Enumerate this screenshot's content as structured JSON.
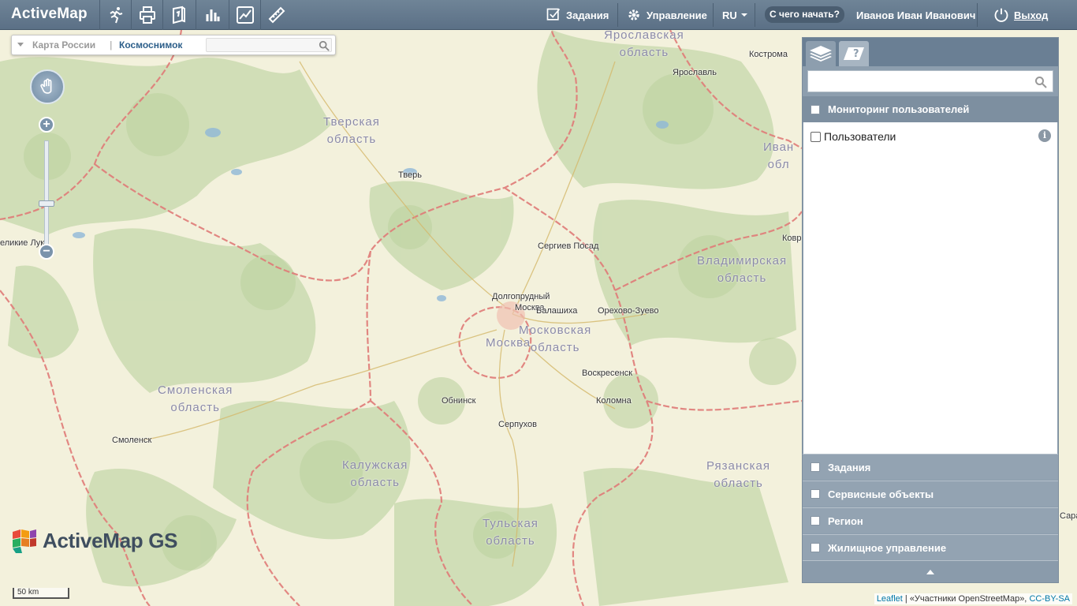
{
  "app": {
    "title": "ActiveMap"
  },
  "toolbar": {
    "tools": [
      "runner-icon",
      "printer-icon",
      "book-icon",
      "bar-chart-icon",
      "line-chart-icon",
      "ruler-icon"
    ]
  },
  "topnav": {
    "tasks_label": "Задания",
    "management_label": "Управление",
    "language": "RU",
    "start_label": "С чего начать?",
    "user_name": "Иванов Иван Иванович",
    "logout_label": "Выход"
  },
  "map": {
    "base_layers": {
      "option1": "Карта России",
      "separator": "|",
      "option2": "Космоснимок"
    },
    "zoom_in": "+",
    "zoom_out": "−",
    "cities": [
      {
        "name": "Кострома"
      },
      {
        "name": "Ярославль"
      },
      {
        "name": "Тверь"
      },
      {
        "name": "Сергиев Посад"
      },
      {
        "name": "Долгопрудный"
      },
      {
        "name": "Москва"
      },
      {
        "name": "Балашиха"
      },
      {
        "name": "Орехово-Зуево"
      },
      {
        "name": "Воскресенск"
      },
      {
        "name": "Обнинск"
      },
      {
        "name": "Коломна"
      },
      {
        "name": "Серпухов"
      },
      {
        "name": "Смоленск"
      },
      {
        "name": "еликие Луки"
      },
      {
        "name": "Ковр"
      },
      {
        "name": "Сара"
      }
    ],
    "regions": [
      {
        "line1": "Ярославская",
        "line2": "область"
      },
      {
        "line1": "Тверская",
        "line2": "область"
      },
      {
        "line1": "Иван",
        "line2": "обл"
      },
      {
        "line1": "Владимирская",
        "line2": "область"
      },
      {
        "line1": "Московская",
        "line2": "область"
      },
      {
        "line1": "Москва",
        "line2": ""
      },
      {
        "line1": "Смоленская",
        "line2": "область"
      },
      {
        "line1": "Калужская",
        "line2": "область"
      },
      {
        "line1": "Рязанская",
        "line2": "область"
      },
      {
        "line1": "Тульская",
        "line2": "область"
      }
    ],
    "brand_logo": "ActiveMap GS",
    "scale": "50 km",
    "attribution": {
      "leaflet": "Leaflet",
      "sep": " | «Участники OpenStreetMap», ",
      "license": "CC-BY-SA"
    }
  },
  "panel": {
    "tabs": [
      "layers-icon",
      "help-map-icon"
    ],
    "search_placeholder": "",
    "active_group": "Мониторинг пользователей",
    "active_group_items": [
      {
        "label": "Пользователи",
        "info": "i"
      }
    ],
    "groups": [
      "Задания",
      "Сервисные объекты",
      "Регион",
      "Жилищное управление"
    ]
  },
  "colors": {
    "topbar": "#5f7489",
    "panel": "#8d9eae",
    "region_border": "#e07070",
    "forest": "#c9dbb0"
  }
}
